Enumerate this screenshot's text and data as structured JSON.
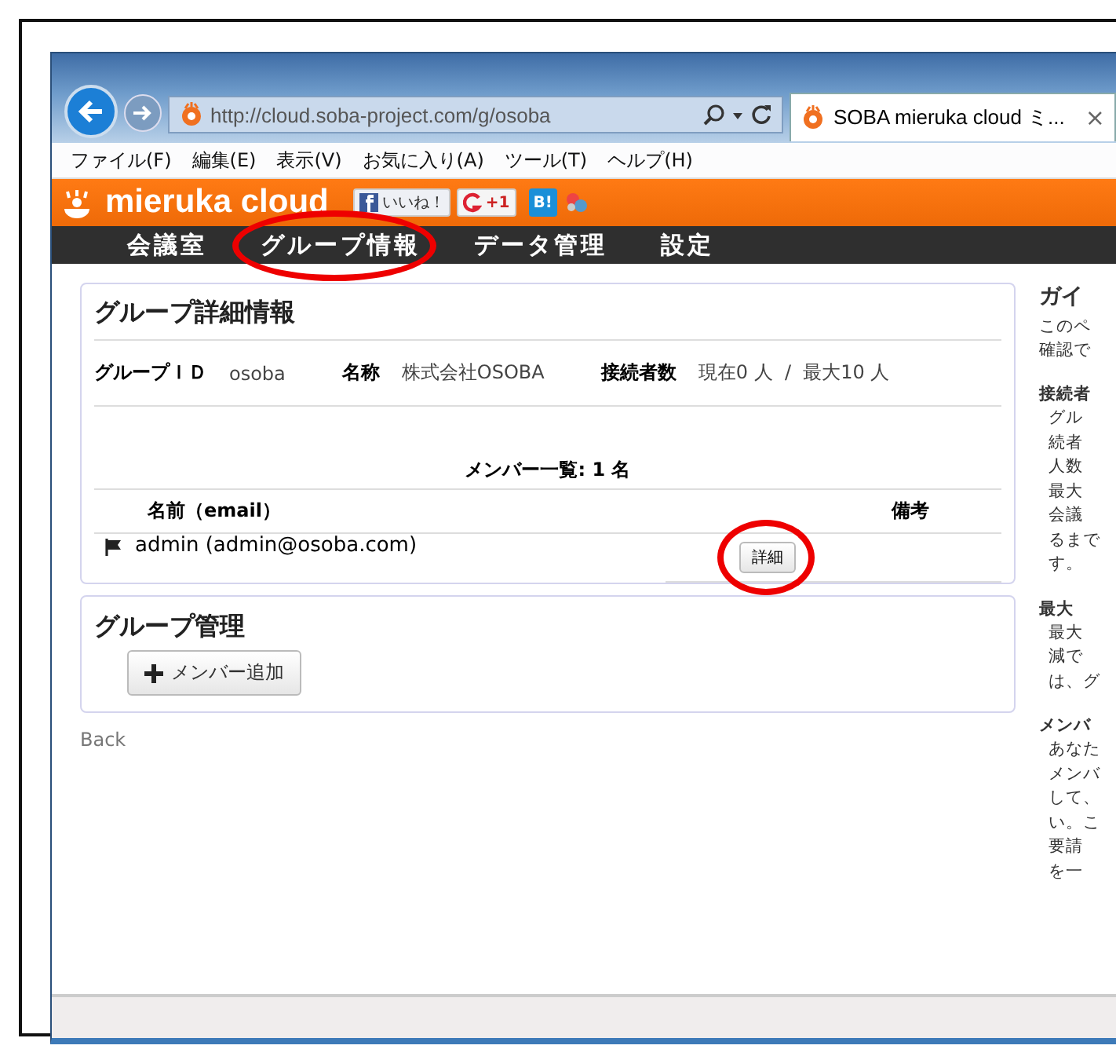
{
  "browser": {
    "url": "http://cloud.soba-project.com/g/osoba",
    "tab": {
      "title": "SOBA mieruka cloud ミ...",
      "close": "×"
    },
    "menu": [
      "ファイル(F)",
      "編集(E)",
      "表示(V)",
      "お気に入り(A)",
      "ツール(T)",
      "ヘルプ(H)"
    ]
  },
  "header": {
    "logo": "mieruka cloud",
    "social": [
      {
        "kind": "facebook",
        "label": "いいね！"
      },
      {
        "kind": "gplus",
        "label": "+1"
      },
      {
        "kind": "hatena",
        "label": "B!"
      },
      {
        "kind": "share"
      }
    ]
  },
  "nav": [
    {
      "label": "会議室",
      "circled": false
    },
    {
      "label": "グループ情報",
      "circled": true
    },
    {
      "label": "データ管理",
      "circled": false
    },
    {
      "label": "設定",
      "circled": false
    }
  ],
  "detail": {
    "title": "グループ詳細情報",
    "fields": [
      {
        "label": "グループＩＤ",
        "value": "osoba"
      },
      {
        "label": "名称",
        "value": "株式会社OSOBA"
      },
      {
        "label": "接続者数",
        "value": "現在0 人  /  最大10 人"
      }
    ],
    "members_title": "メンバー一覧: 1 名",
    "columns": [
      "名前（email）",
      "備考"
    ],
    "rows": [
      {
        "name": "admin (admin@osoba.com)",
        "action": "詳細",
        "circled": true
      }
    ]
  },
  "management": {
    "title": "グループ管理",
    "button": "メンバー追加"
  },
  "back": "Back",
  "guide": {
    "title": "ガイ",
    "intro": [
      "このペ",
      "確認で"
    ],
    "sections": [
      {
        "heading": "接続者",
        "lines": [
          "グル",
          "続者",
          "人数",
          "最大",
          "会議",
          "るまで",
          "す。"
        ]
      },
      {
        "heading": "最大",
        "lines": [
          "最大",
          "減で",
          "は、グ"
        ]
      },
      {
        "heading": "メンバ",
        "lines": [
          "あなた",
          "メンバ",
          "して、",
          "い。こ",
          "要請",
          "を一"
        ]
      }
    ]
  }
}
